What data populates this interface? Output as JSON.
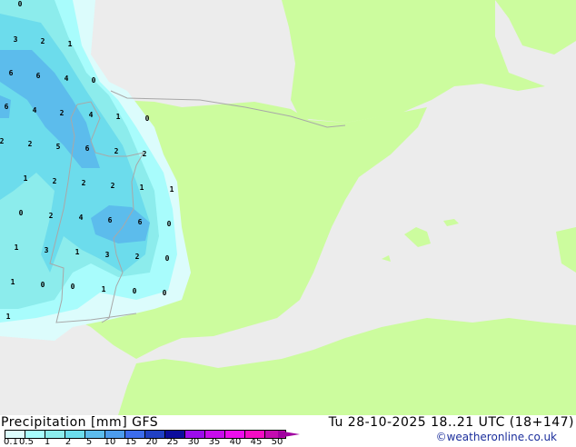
{
  "map": {
    "colors": {
      "sea": "#ececec",
      "land": "#ccfc9e",
      "border": "#a8a8a8"
    },
    "value_labels": [
      "0",
      "3",
      "2",
      "1",
      "6",
      "6",
      "4",
      "0",
      "6",
      "4",
      "2",
      "4",
      "1",
      "0",
      "2",
      "2",
      "5",
      "6",
      "2",
      "2",
      "1",
      "2",
      "2",
      "2",
      "1",
      "1",
      "0",
      "2",
      "4",
      "6",
      "6",
      "0",
      "1",
      "3",
      "1",
      "3",
      "2",
      "0",
      "1",
      "0",
      "0",
      "1",
      "0",
      "0",
      "1"
    ]
  },
  "legend": {
    "title": "Precipitation [mm]  GFS",
    "datetime": "Tu 28-10-2025 18..21 UTC (18+147)",
    "credit": "©weatheronline.co.uk",
    "ticks": [
      "0.1",
      "0.5",
      "1",
      "2",
      "5",
      "10",
      "15",
      "20",
      "25",
      "30",
      "35",
      "40",
      "45",
      "50"
    ],
    "colors": [
      "#dcfcfc",
      "#a8fcfc",
      "#8cecec",
      "#6cdcec",
      "#5cbcec",
      "#4c9cec",
      "#3c6cec",
      "#2040c4",
      "#0c0c9c",
      "#9c0cec",
      "#c80cec",
      "#ec0cec",
      "#f40cc4",
      "#c40cb0"
    ]
  }
}
